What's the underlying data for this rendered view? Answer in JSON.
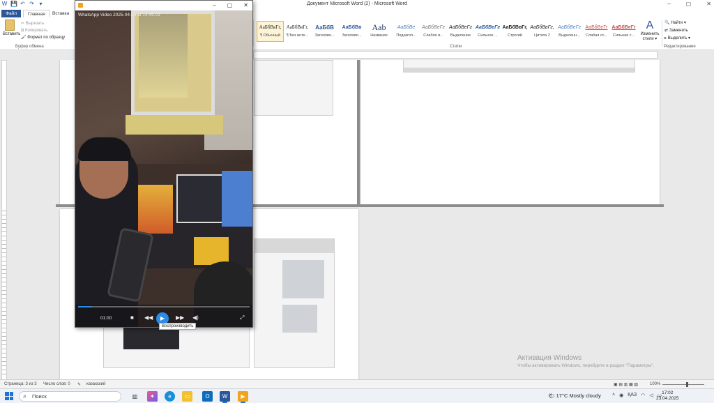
{
  "word": {
    "title": "Документ Microsoft Word (2)  -  Microsoft Word",
    "qat": [
      "W",
      "💾",
      "↶",
      "↷",
      "▾"
    ],
    "window_controls": [
      "–",
      "▢",
      "✕"
    ],
    "tabs": {
      "file": "Файл",
      "home": "Главная",
      "insert": "Вставка"
    },
    "clipboard": {
      "paste": "Вставить",
      "cut": "Вырезать",
      "copy": "Копировать",
      "format_painter": "Формат по образцу",
      "group": "Буфер обмена"
    },
    "styles": {
      "group": "Стили",
      "items": [
        {
          "sample": "АаБбВвГг,",
          "name": "¶ Обычный"
        },
        {
          "sample": "АаБбВвГг,",
          "name": "¶ Без инте..."
        },
        {
          "sample": "АаБбВ",
          "name": "Заголово..."
        },
        {
          "sample": "АаБбВв",
          "name": "Заголово..."
        },
        {
          "sample": "Aab",
          "name": "Название"
        },
        {
          "sample": "АаБбВе",
          "name": "Подзагол..."
        },
        {
          "sample": "АаБбВеГг",
          "name": "Слабое в..."
        },
        {
          "sample": "АаБбВеГг",
          "name": "Выделение"
        },
        {
          "sample": "АаБбВеГг",
          "name": "Сильное ..."
        },
        {
          "sample": "АаБбВвГг,",
          "name": "Строгий"
        },
        {
          "sample": "АаБбВвГг,",
          "name": "Цитата 2"
        },
        {
          "sample": "АаБбВеГг",
          "name": "Выделенн..."
        },
        {
          "sample": "АаБбВеГг",
          "name": "Слабая сс..."
        },
        {
          "sample": "АаБбВеГг",
          "name": "Сильная с..."
        }
      ]
    },
    "change_styles": {
      "glyph": "A",
      "label": "Изменить стили ▾"
    },
    "editing": {
      "find": "Найти ▾",
      "replace": "Заменить",
      "select": "Выделить ▾",
      "group": "Редактирование"
    },
    "watermark": {
      "line1": "Активация Windows",
      "line2": "Чтобы активировать Windows, перейдите в раздел \"Параметры\"."
    },
    "status": {
      "page": "Страница: 3 из 3",
      "words": "Число слов: 0",
      "language": "казахский",
      "zoom": "100%"
    }
  },
  "player": {
    "title": "WhatsApp Video 2025-04-23 at 14.49.03",
    "window_controls": [
      "–",
      "▢",
      "✕"
    ],
    "time": "01:00",
    "progress": 0.08,
    "buttons": {
      "stop": "■",
      "prev": "◀◀",
      "play": "▶",
      "next": "▶▶",
      "volume": "◀)",
      "fullscreen": "⤢"
    },
    "tooltip": "Воспроизводить"
  },
  "taskbar": {
    "search_placeholder": "Поиск",
    "weather": "17°C  Mostly cloudy",
    "lang": "ҚАЗ",
    "time": "17:02",
    "date": "23.04.2025"
  },
  "colors": {
    "word_blue": "#2b579a",
    "accent_blue": "#2b8be6",
    "active_style_border": "#e8b84a"
  }
}
